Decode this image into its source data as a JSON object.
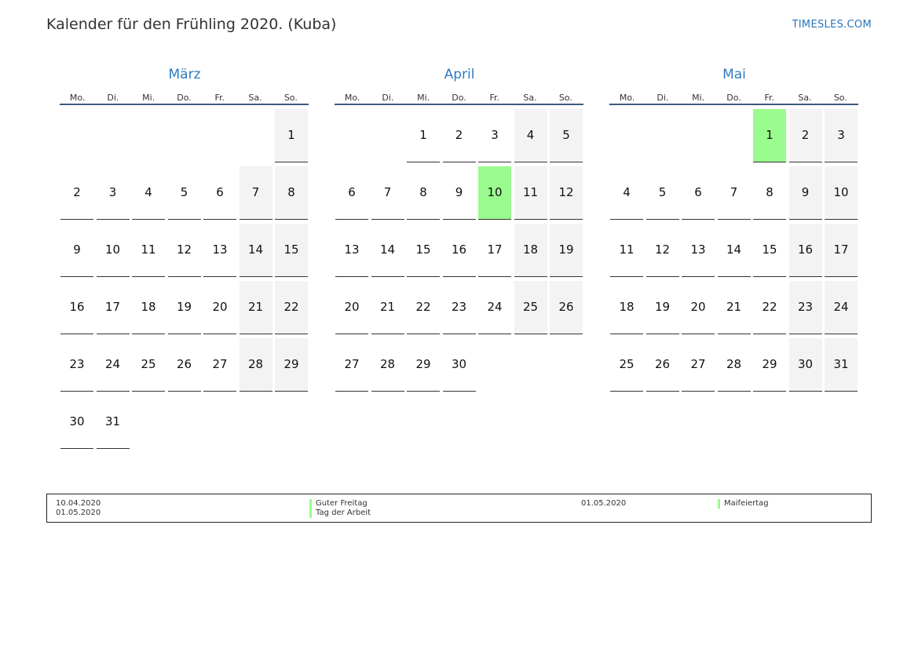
{
  "header": {
    "title": "Kalender für den Frühling 2020. (Kuba)",
    "site": "TIMESLES.COM"
  },
  "weekday_labels": [
    "Mo.",
    "Di.",
    "Mi.",
    "Do.",
    "Fr.",
    "Sa.",
    "So."
  ],
  "months": [
    {
      "name": "März",
      "first_weekday": 6,
      "days": 31,
      "holidays": []
    },
    {
      "name": "April",
      "first_weekday": 2,
      "days": 30,
      "holidays": [
        10
      ]
    },
    {
      "name": "Mai",
      "first_weekday": 4,
      "days": 31,
      "holidays": [
        1
      ]
    }
  ],
  "colors": {
    "holiday": "#9afb8e",
    "weekend": "#f3f3f3",
    "month_title": "#2f7bbf",
    "rule": "#3d5a7a"
  },
  "legend": {
    "col1": [
      "10.04.2020",
      "01.05.2020"
    ],
    "col2": [
      "Guter Freitag",
      "Tag der Arbeit"
    ],
    "col3": [
      "01.05.2020"
    ],
    "col4": [
      "Maifeiertag"
    ]
  }
}
